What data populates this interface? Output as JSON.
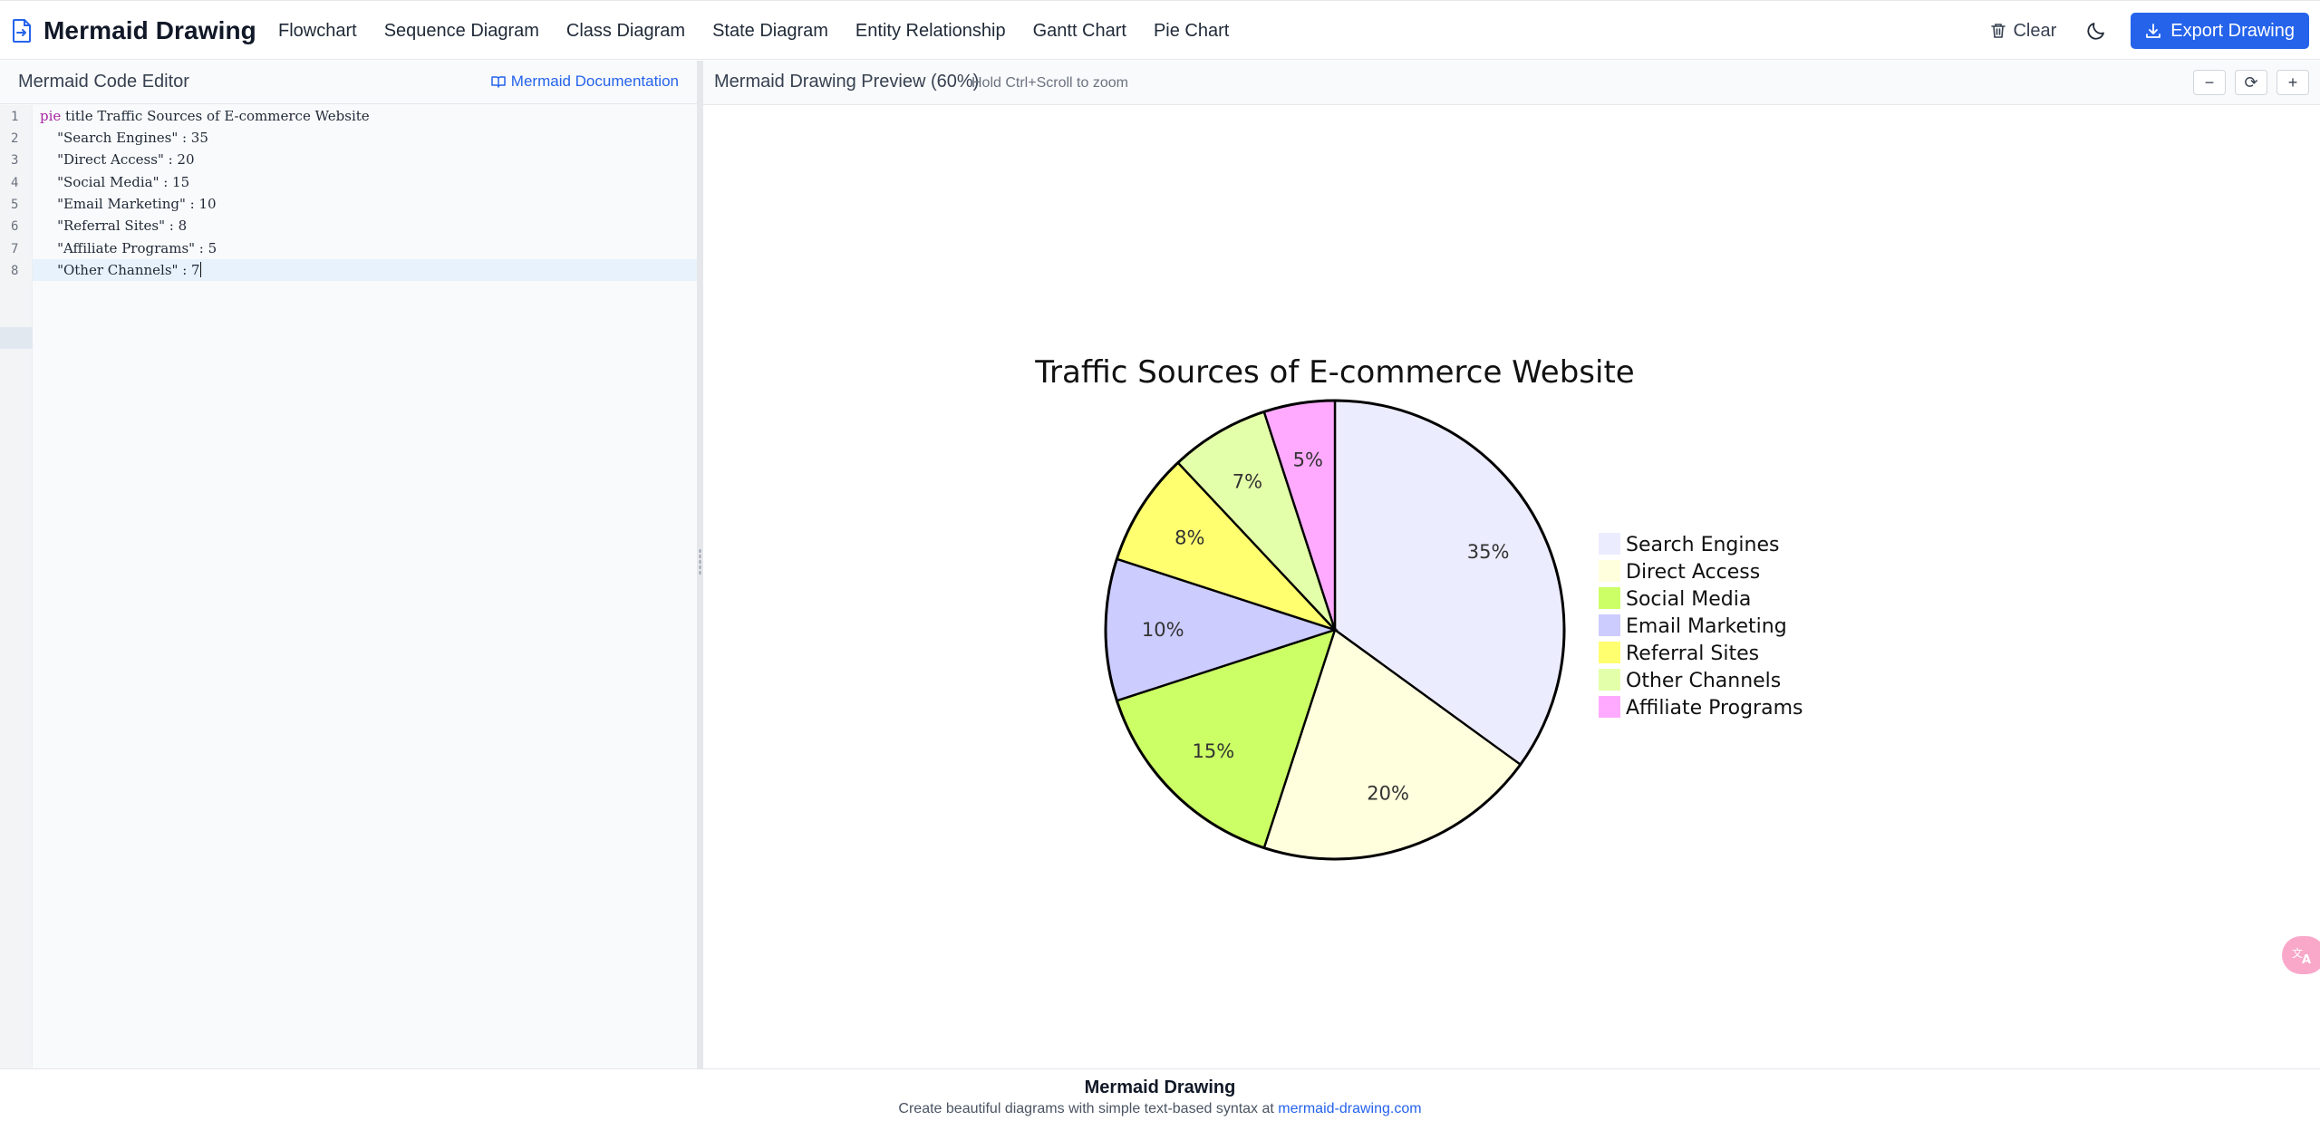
{
  "header": {
    "app_title": "Mermaid Drawing",
    "nav": [
      "Flowchart",
      "Sequence Diagram",
      "Class Diagram",
      "State Diagram",
      "Entity Relationship",
      "Gantt Chart",
      "Pie Chart"
    ],
    "clear_label": "Clear",
    "export_label": "Export Drawing",
    "icons": {
      "logo": "document-arrow-icon",
      "clear": "trash-icon",
      "theme": "moon-icon",
      "export": "download-icon"
    },
    "accent_color": "#2563eb"
  },
  "editor": {
    "title": "Mermaid Code Editor",
    "docs_link": "Mermaid Documentation",
    "lines": [
      "pie title Traffic Sources of E-commerce Website",
      "    \"Search Engines\" : 35",
      "    \"Direct Access\" : 20",
      "    \"Social Media\" : 15",
      "    \"Email Marketing\" : 10",
      "    \"Referral Sites\" : 8",
      "    \"Affiliate Programs\" : 5",
      "    \"Other Channels\" : 7"
    ],
    "active_line": 8
  },
  "preview": {
    "title": "Mermaid Drawing Preview (60%)",
    "zoom_hint": "Hold Ctrl+Scroll to zoom",
    "zoom_out": "−",
    "zoom_reset": "⟳",
    "zoom_in": "+"
  },
  "chart_data": {
    "type": "pie",
    "title": "Traffic Sources of E-commerce Website",
    "legend_position": "right",
    "slices": [
      {
        "label": "Search Engines",
        "value": 35,
        "display": "35%",
        "color": "#ececff"
      },
      {
        "label": "Direct Access",
        "value": 20,
        "display": "20%",
        "color": "#ffffde"
      },
      {
        "label": "Social Media",
        "value": 15,
        "display": "15%",
        "color": "#ccff66"
      },
      {
        "label": "Email Marketing",
        "value": 10,
        "display": "10%",
        "color": "#ccccff"
      },
      {
        "label": "Referral Sites",
        "value": 8,
        "display": "8%",
        "color": "#ffff70"
      },
      {
        "label": "Other Channels",
        "value": 7,
        "display": "7%",
        "color": "#e4ffa9"
      },
      {
        "label": "Affiliate Programs",
        "value": 5,
        "display": "5%",
        "color": "#ffaaff"
      }
    ]
  },
  "footer": {
    "title": "Mermaid Drawing",
    "text": "Create beautiful diagrams with simple text-based syntax at",
    "link": "mermaid-drawing.com"
  }
}
